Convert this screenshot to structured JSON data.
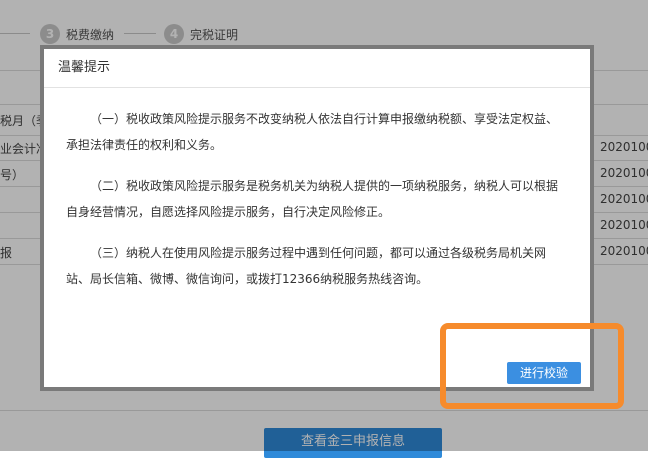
{
  "steps": [
    {
      "number": "3",
      "label": "税费缴纳"
    },
    {
      "number": "4",
      "label": "完税证明"
    }
  ],
  "background": {
    "rows_left": [
      "税月（季",
      "业会计准",
      "号）",
      "报"
    ],
    "rows_right": [
      "2020100",
      "2020100",
      "2020100",
      "2020100",
      "2020100"
    ],
    "bottom_button": "查看金三申报信息"
  },
  "modal": {
    "title": "温馨提示",
    "paragraphs": [
      "（一）税收政策风险提示服务不改变纳税人依法自行计算申报缴纳税额、享受法定权益、承担法律责任的权利和义务。",
      "（二）税收政策风险提示服务是税务机关为纳税人提供的一项纳税服务，纳税人可以根据自身经营情况，自愿选择风险提示服务，自行决定风险修正。",
      "（三）纳税人在使用风险提示服务过程中遇到任何问题，都可以通过各级税务局机关网站、局长信箱、微博、微信询问，或拨打12366纳税服务热线咨询。"
    ],
    "confirm_button": "进行校验"
  },
  "colors": {
    "primary": "#3b8fe1",
    "highlight": "#f68b2c"
  }
}
